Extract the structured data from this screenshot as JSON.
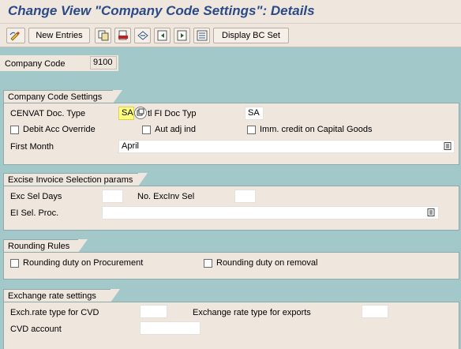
{
  "title": "Change View \"Company Code Settings\": Details",
  "toolbar": {
    "new_entries": "New Entries",
    "display_bc_set": "Display BC Set",
    "icons": [
      "change-mode-icon",
      "copy-icon",
      "delete-icon",
      "undo-icon",
      "previous-entry-icon",
      "next-entry-icon",
      "variable-list-icon"
    ]
  },
  "company_code": {
    "label": "Company Code",
    "value": "9100"
  },
  "company_code_settings": {
    "title": "Company Code Settings",
    "cenvat_doc_type_label": "CENVAT Doc. Type",
    "cenvat_doc_type_value": "SA",
    "fi_doc_type_label": "tl FI Doc Typ",
    "fi_doc_type_value": "SA",
    "debit_acc_override": "Debit Acc Override",
    "aut_adj_ind": "Aut adj ind",
    "imm_credit": "Imm. credit on Capital Goods",
    "first_month_label": "First Month",
    "first_month_value": "April"
  },
  "excise_invoice": {
    "title": "Excise Invoice Selection params",
    "exc_sel_days": "Exc Sel Days",
    "no_excinv_sel": "No. ExcInv Sel",
    "ei_sel_proc": "EI Sel. Proc."
  },
  "rounding": {
    "title": "Rounding Rules",
    "procurement": "Rounding duty on Procurement",
    "removal": "Rounding duty on removal"
  },
  "exchange_rate": {
    "title": "Exchange rate settings",
    "cvd_label": "Exch.rate type for CVD",
    "exports_label": "Exchange rate type for exports",
    "cvd_account_label": "CVD account"
  },
  "colors": {
    "title": "#2b4a86",
    "background": "#a3c8c9",
    "panel": "#efe6de",
    "highlight": "#ffff80"
  }
}
